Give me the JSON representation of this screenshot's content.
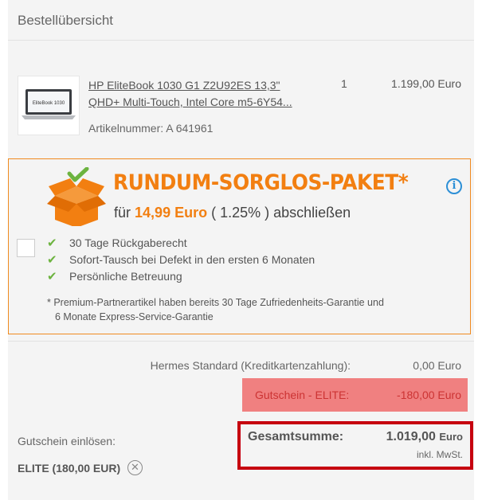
{
  "header": {
    "title": "Bestellübersicht"
  },
  "product": {
    "name_line1": "HP EliteBook 1030 G1 Z2U92ES 13,3\"",
    "name_line2": "QHD+ Multi-Touch, Intel Core m5-6Y54...",
    "quantity": "1",
    "price": "1.199,00 Euro",
    "article_number": "Artikelnummer: A 641961",
    "thumbnail_text": "EliteBook 1030"
  },
  "package": {
    "title": "RUNDUM-SORGLOS-PAKET*",
    "sub_prefix": "für",
    "sub_price": "14,99 Euro",
    "sub_suffix": "( 1.25% ) abschließen",
    "features": [
      "30 Tage Rückgaberecht",
      "Sofort-Tausch bei Defekt in den ersten 6 Monaten",
      "Persönliche Betreuung"
    ],
    "note_line1": "* Premium-Partnerartikel haben bereits 30 Tage Zufriedenheits-Garantie und",
    "note_line2": "6 Monate Express-Service-Garantie",
    "accent_color": "#f27f11"
  },
  "shipping": {
    "label": "Hermes Standard (Kreditkartenzahlung):",
    "value": "0,00 Euro"
  },
  "voucher": {
    "label": "Gutschein - ELITE:",
    "value": "-180,00 Euro"
  },
  "total": {
    "label": "Gesamtsumme:",
    "value": "1.019,00",
    "currency": "Euro",
    "tax_note": "inkl. MwSt."
  },
  "redeem": {
    "label": "Gutschein einlösen:",
    "code": "ELITE (180,00 EUR)"
  }
}
